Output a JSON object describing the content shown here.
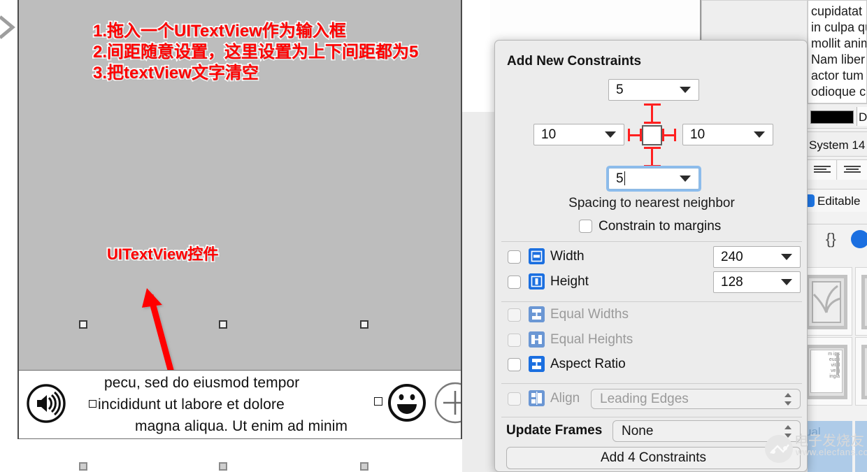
{
  "canvas": {
    "annotations": {
      "line1": "1.拖入一个UITextView作为输入框",
      "line2": "2.间距随意设置，这里设置为上下间距都为5",
      "line3": "3.把textView文字清空",
      "widget_label": "UITextView控件"
    },
    "bottom_bar": {
      "speaker_icon": "speaker-volume-icon",
      "text_line1": "pecu, sed do eiusmod tempor",
      "text_line2": "incididunt ut labore et dolore",
      "text_line3": "magna aliqua. Ut enim ad minim",
      "smiley_icon": "smiley-face-icon",
      "plus_icon": "plus-circle-icon"
    }
  },
  "popover": {
    "title": "Add New Constraints",
    "spacing": {
      "top_value": "5",
      "left_value": "10",
      "right_value": "10",
      "bottom_value": "5",
      "caption": "Spacing to nearest neighbor",
      "constrain_to_margins_label": "Constrain to margins",
      "constrain_to_margins_checked": false
    },
    "rows": [
      {
        "label": "Width",
        "value": "240",
        "checked": false,
        "enabled": true,
        "icon": "width-constraint-icon"
      },
      {
        "label": "Height",
        "value": "128",
        "checked": false,
        "enabled": true,
        "icon": "height-constraint-icon"
      },
      {
        "label": "Equal Widths",
        "value": "",
        "checked": false,
        "enabled": false,
        "icon": "equal-widths-icon"
      },
      {
        "label": "Equal Heights",
        "value": "",
        "checked": false,
        "enabled": false,
        "icon": "equal-heights-icon"
      },
      {
        "label": "Aspect Ratio",
        "value": "",
        "checked": false,
        "enabled": true,
        "icon": "aspect-ratio-icon"
      }
    ],
    "align": {
      "label": "Align",
      "value": "Leading Edges",
      "checked": false,
      "enabled": false,
      "icon": "align-icon"
    },
    "update_frames": {
      "label": "Update Frames",
      "value": "None"
    },
    "add_button_label": "Add 4 Constraints"
  },
  "inspector": {
    "text_lines": [
      "cupidatat n",
      "in culpa qu",
      "mollit anim",
      "Nam liber t",
      "actor tum",
      "odioque ci"
    ],
    "color_swatch": "#000000",
    "color_label": "De",
    "font_label": "System 14",
    "alignment_icons": [
      "align-left-icon",
      "align-center-icon"
    ],
    "editable_label": "Editable",
    "editable_checked": true,
    "braces_label": "{}",
    "blue_icon": "detect-data-icon",
    "thumbnail_text": [
      "m ips",
      "euati",
      "vital",
      "venj",
      "ingia"
    ],
    "selected_label": "ual"
  },
  "watermark": {
    "cn": "电子发烧友",
    "en": "www.elecfans.com"
  },
  "colors": {
    "accent_blue": "#1b6fe0",
    "annotation_red": "#ff0000",
    "canvas_grey": "#bdbdbd",
    "popover_bg": "#ececec"
  }
}
